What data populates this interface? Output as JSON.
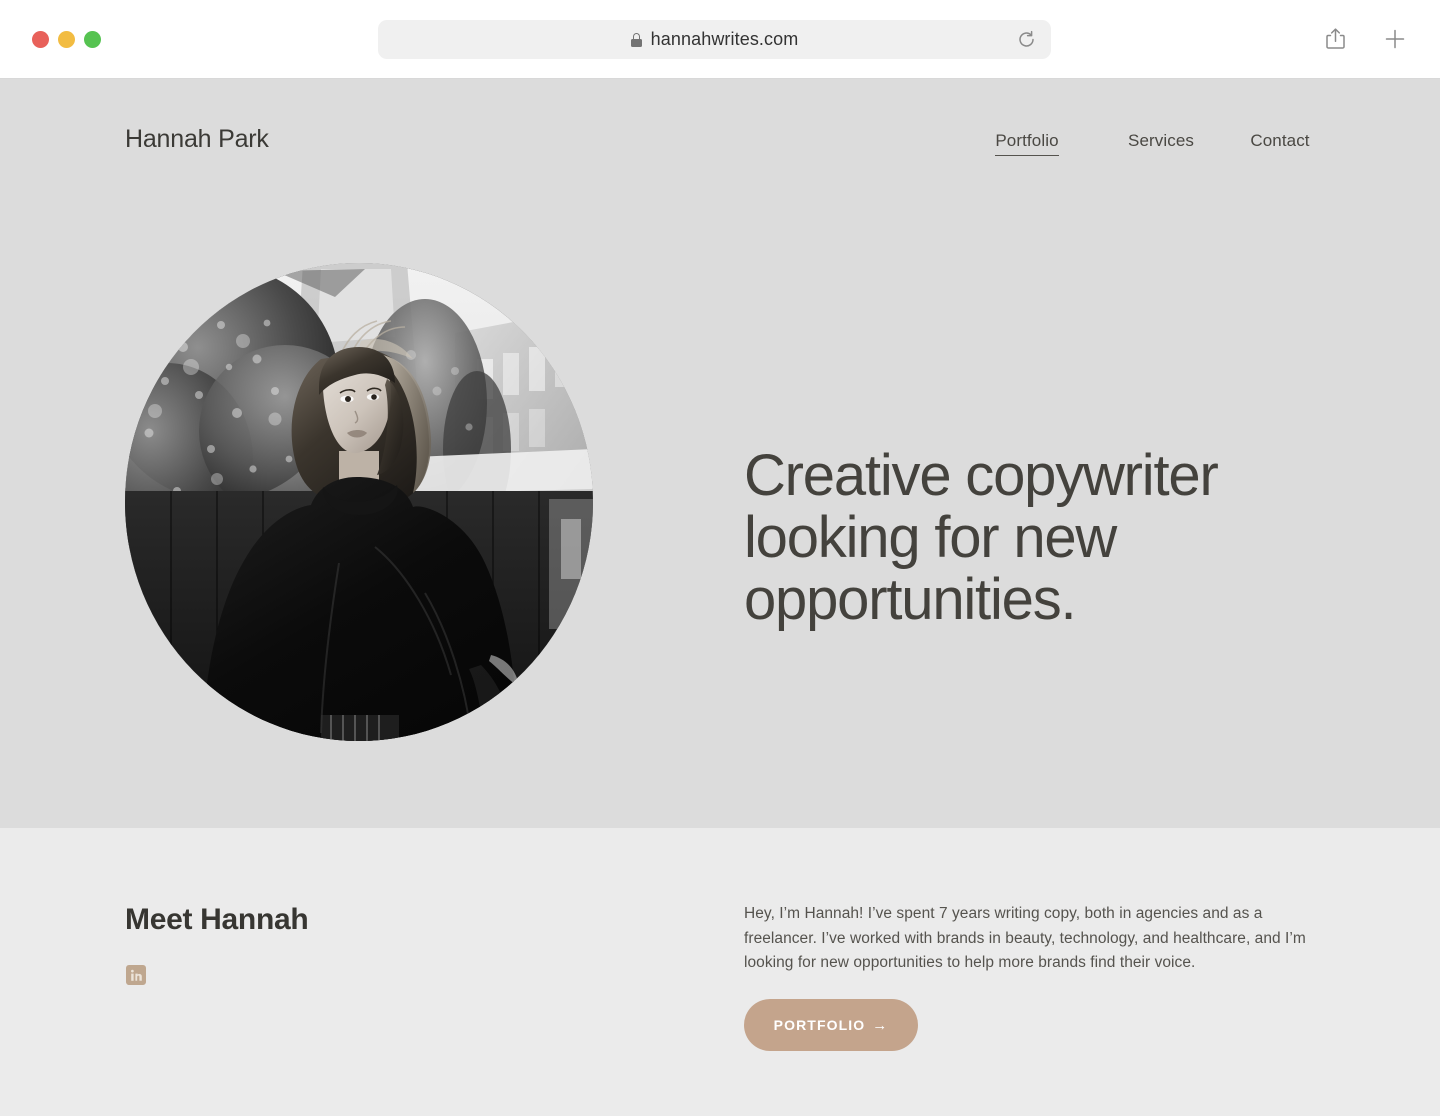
{
  "browser": {
    "url": "hannahwrites.com",
    "lock_icon": "lock-icon",
    "reload_icon": "reload-icon",
    "share_icon": "share-icon",
    "new_tab_icon": "plus-icon",
    "traffic_lights": [
      "close-red",
      "minimize-yellow",
      "maximize-green"
    ],
    "colors": {
      "red": "#E8615A",
      "yellow": "#F2BC42",
      "green": "#56C351"
    }
  },
  "site": {
    "brand": "Hannah Park",
    "nav": [
      {
        "label": "Portfolio",
        "active": true
      },
      {
        "label": "Services",
        "active": false
      },
      {
        "label": "Contact",
        "active": false
      }
    ]
  },
  "hero": {
    "headline": "Creative copywriter looking for new opportunities.",
    "portrait_alt": "black-and-white circular portrait of a woman with a short bob haircut wearing a black turtleneck, trees and a building behind her",
    "background_color": "#DCDCDC",
    "text_color": "#44423D"
  },
  "about": {
    "title": "Meet Hannah",
    "paragraph": "Hey, I’m Hannah! I’ve spent 7 years writing copy, both in agencies and as a freelancer. I’ve worked with brands in beauty, technology, and healthcare, and I’m looking for new opportunities to help more brands find their voice.",
    "social": [
      {
        "name": "linkedin",
        "label": "in"
      }
    ],
    "cta": {
      "label": "PORTFOLIO",
      "arrow": "→",
      "color": "#C4A48C"
    },
    "background_color": "#EBEBEB"
  }
}
